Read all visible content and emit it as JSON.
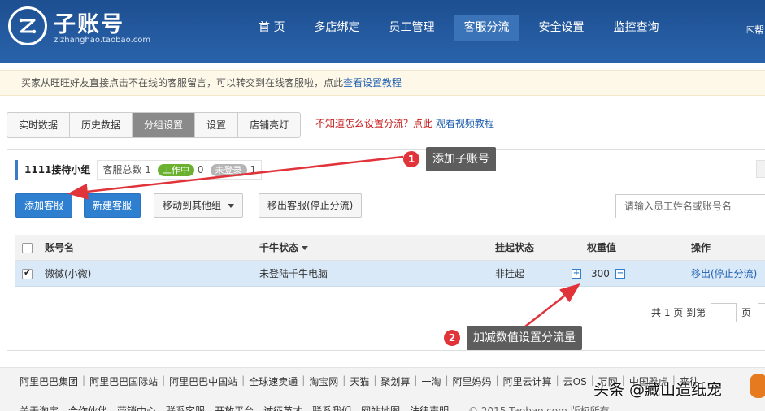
{
  "header": {
    "brand_title": "子账号",
    "brand_sub": "zizhanghao.taobao.com",
    "nav": [
      "首 页",
      "多店绑定",
      "员工管理",
      "客服分流",
      "安全设置",
      "监控查询"
    ],
    "active_nav": 3,
    "help_link": "帮"
  },
  "notice": {
    "text": "买家从旺旺好友直接点击不在线的客服留言，可以转交到在线客服啦，点此",
    "link": "查看设置教程"
  },
  "tabs": {
    "items": [
      "实时数据",
      "历史数据",
      "分组设置",
      "设置",
      "店铺亮灯"
    ],
    "active": 2,
    "hint_text": "不知道怎么设置分流？点此 ",
    "hint_link": "观看视频教程"
  },
  "group": {
    "name": "1111接待小组",
    "total_label": "客服总数",
    "total": "1",
    "working_label": "工作中",
    "working": "0",
    "offline_label": "未登录",
    "offline": "1"
  },
  "toolbar": {
    "add_service": "添加客服",
    "new_service": "新建客服",
    "move_group": "移动到其他组",
    "remove_service": "移出客服(停止分流)",
    "search_placeholder": "请输入员工姓名或账号名"
  },
  "table": {
    "columns": [
      "账号名",
      "千牛状态",
      "挂起状态",
      "权重值",
      "操作"
    ],
    "rows": [
      {
        "account": "微微(小微)",
        "qianniu_status": "未登陆千牛电脑",
        "suspend_status": "非挂起",
        "weight": "300",
        "action": "移出(停止分流)",
        "checked": true
      }
    ]
  },
  "pager": {
    "text_total": "共 1 页 到第",
    "text_page": "页"
  },
  "callouts": {
    "first_num": "1",
    "first_text": "添加子账号",
    "second_num": "2",
    "second_text": "加减数值设置分流量"
  },
  "footer": {
    "links": [
      "阿里巴巴集团",
      "阿里巴巴国际站",
      "阿里巴巴中国站",
      "全球速卖通",
      "淘宝网",
      "天猫",
      "聚划算",
      "一淘",
      "阿里妈妈",
      "阿里云计算",
      "云OS",
      "万网",
      "中国雅虎",
      "来往"
    ],
    "links2": [
      "关于淘宝",
      "合作伙伴",
      "营销中心",
      "联系客服",
      "开放平台",
      "诚征英才",
      "联系我们",
      "网站地图",
      "法律声明"
    ],
    "copyright": "© 2015 Taobao.com 版权所有",
    "watermark": "头条 @藏山造纸宠"
  },
  "colors": {
    "header_bg": "#1d4f91",
    "accent": "#2f7fd1",
    "callout_num": "#e0333a",
    "selected_row": "#d9e9f8"
  }
}
